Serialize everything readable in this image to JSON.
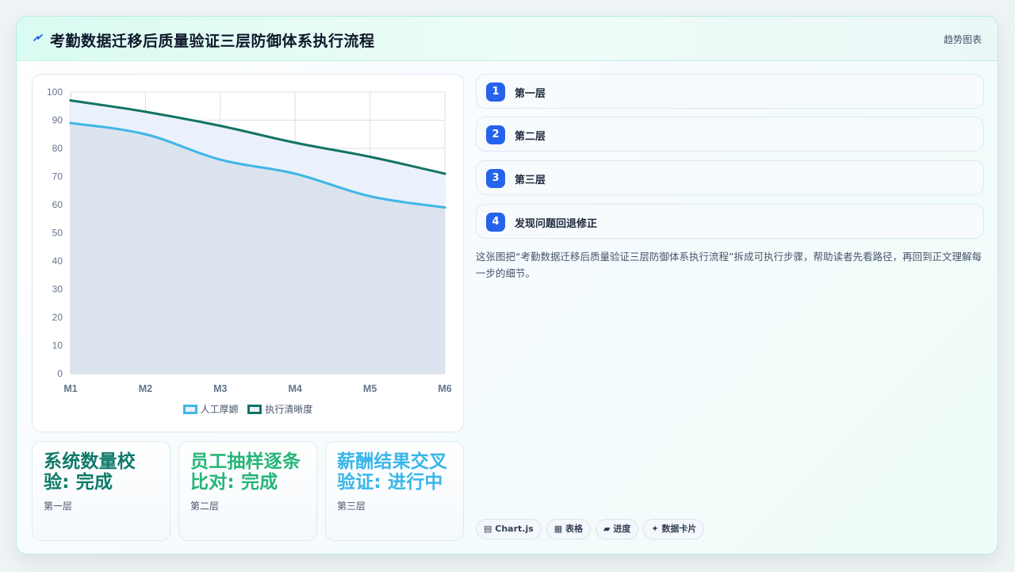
{
  "header": {
    "icon": "lightning-icon",
    "title": "考勤数据迁移后质量验证三层防御体系执行流程",
    "badge": "趋势图表"
  },
  "chart_data": {
    "type": "area",
    "categories": [
      "M1",
      "M2",
      "M3",
      "M4",
      "M5",
      "M6"
    ],
    "series": [
      {
        "name": "人工厚嫄",
        "values": [
          89,
          85,
          76,
          71,
          63,
          59
        ],
        "color": "#3fb6e6",
        "fill": "#dbe3ef"
      },
      {
        "name": "执行清晰度",
        "values": [
          97,
          93,
          88,
          82,
          77,
          71
        ],
        "color": "#147365",
        "fill": "#eaf1fd"
      }
    ],
    "ylim": [
      0,
      100
    ],
    "yticks": [
      0,
      10,
      20,
      30,
      40,
      50,
      60,
      70,
      80,
      90,
      100
    ],
    "grid": true,
    "legend": "bottom"
  },
  "kpis": [
    {
      "title": "系统数量校验: 完成",
      "sub": "第一层",
      "color": "#0f7a69"
    },
    {
      "title": "员工抽样逐条比对: 完成",
      "sub": "第二层",
      "color": "#25b578"
    },
    {
      "title": "薪酬结果交叉验证: 进行中",
      "sub": "第三层",
      "color": "#38b6e8"
    }
  ],
  "steps": [
    {
      "num": "1",
      "label": "第一层"
    },
    {
      "num": "2",
      "label": "第二层"
    },
    {
      "num": "3",
      "label": "第三层"
    },
    {
      "num": "4",
      "label": "发现问题回退修正"
    }
  ],
  "description": "这张图把“考勤数据迁移后质量验证三层防御体系执行流程”拆成可执行步骤，帮助读者先看路径，再回到正文理解每一步的细节。",
  "tags": [
    {
      "icon": "▤",
      "label": "Chart.js"
    },
    {
      "icon": "▦",
      "label": "表格"
    },
    {
      "icon": "▰",
      "label": "进度"
    },
    {
      "icon": "✦",
      "label": "数据卡片"
    }
  ]
}
